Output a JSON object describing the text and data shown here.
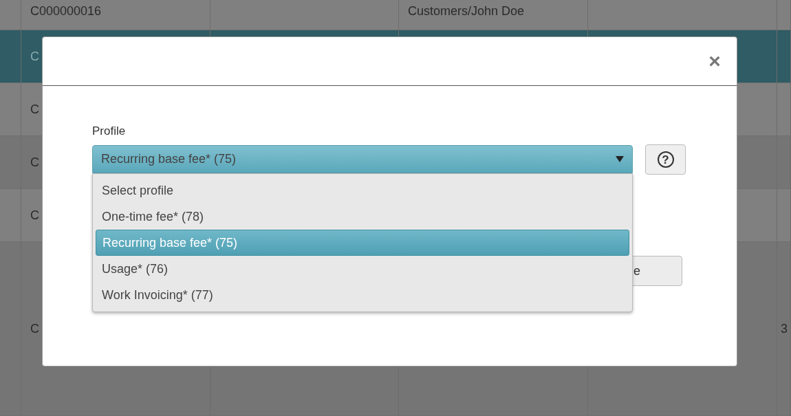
{
  "table": {
    "rows": [
      {
        "selected": false,
        "cells": [
          "",
          "C000000016",
          "",
          "Customers/John Doe",
          "",
          ""
        ]
      },
      {
        "selected": true,
        "cells": [
          "",
          "C",
          "",
          "",
          "",
          ""
        ]
      },
      {
        "selected": false,
        "cells": [
          "",
          "C",
          "",
          "",
          "",
          ""
        ]
      },
      {
        "selected": false,
        "cells": [
          "",
          "C",
          "",
          "",
          "",
          ""
        ]
      },
      {
        "selected": false,
        "cells": [
          "",
          "C",
          "",
          "",
          "",
          ""
        ]
      },
      {
        "selected": false,
        "cells": [
          "",
          "C",
          "",
          "",
          "",
          "3"
        ]
      }
    ]
  },
  "dialog": {
    "close": "×",
    "profile_label": "Profile",
    "select": {
      "value": "Recurring base fee* (75)",
      "expanded": true,
      "options": [
        {
          "label": "Select profile",
          "selected": false
        },
        {
          "label": "One-time fee* (78)",
          "selected": false
        },
        {
          "label": "Recurring base fee* (75)",
          "selected": true
        },
        {
          "label": "Usage* (76)",
          "selected": false
        },
        {
          "label": "Work Invoicing* (77)",
          "selected": false
        }
      ]
    },
    "help": "?",
    "button": "e"
  }
}
